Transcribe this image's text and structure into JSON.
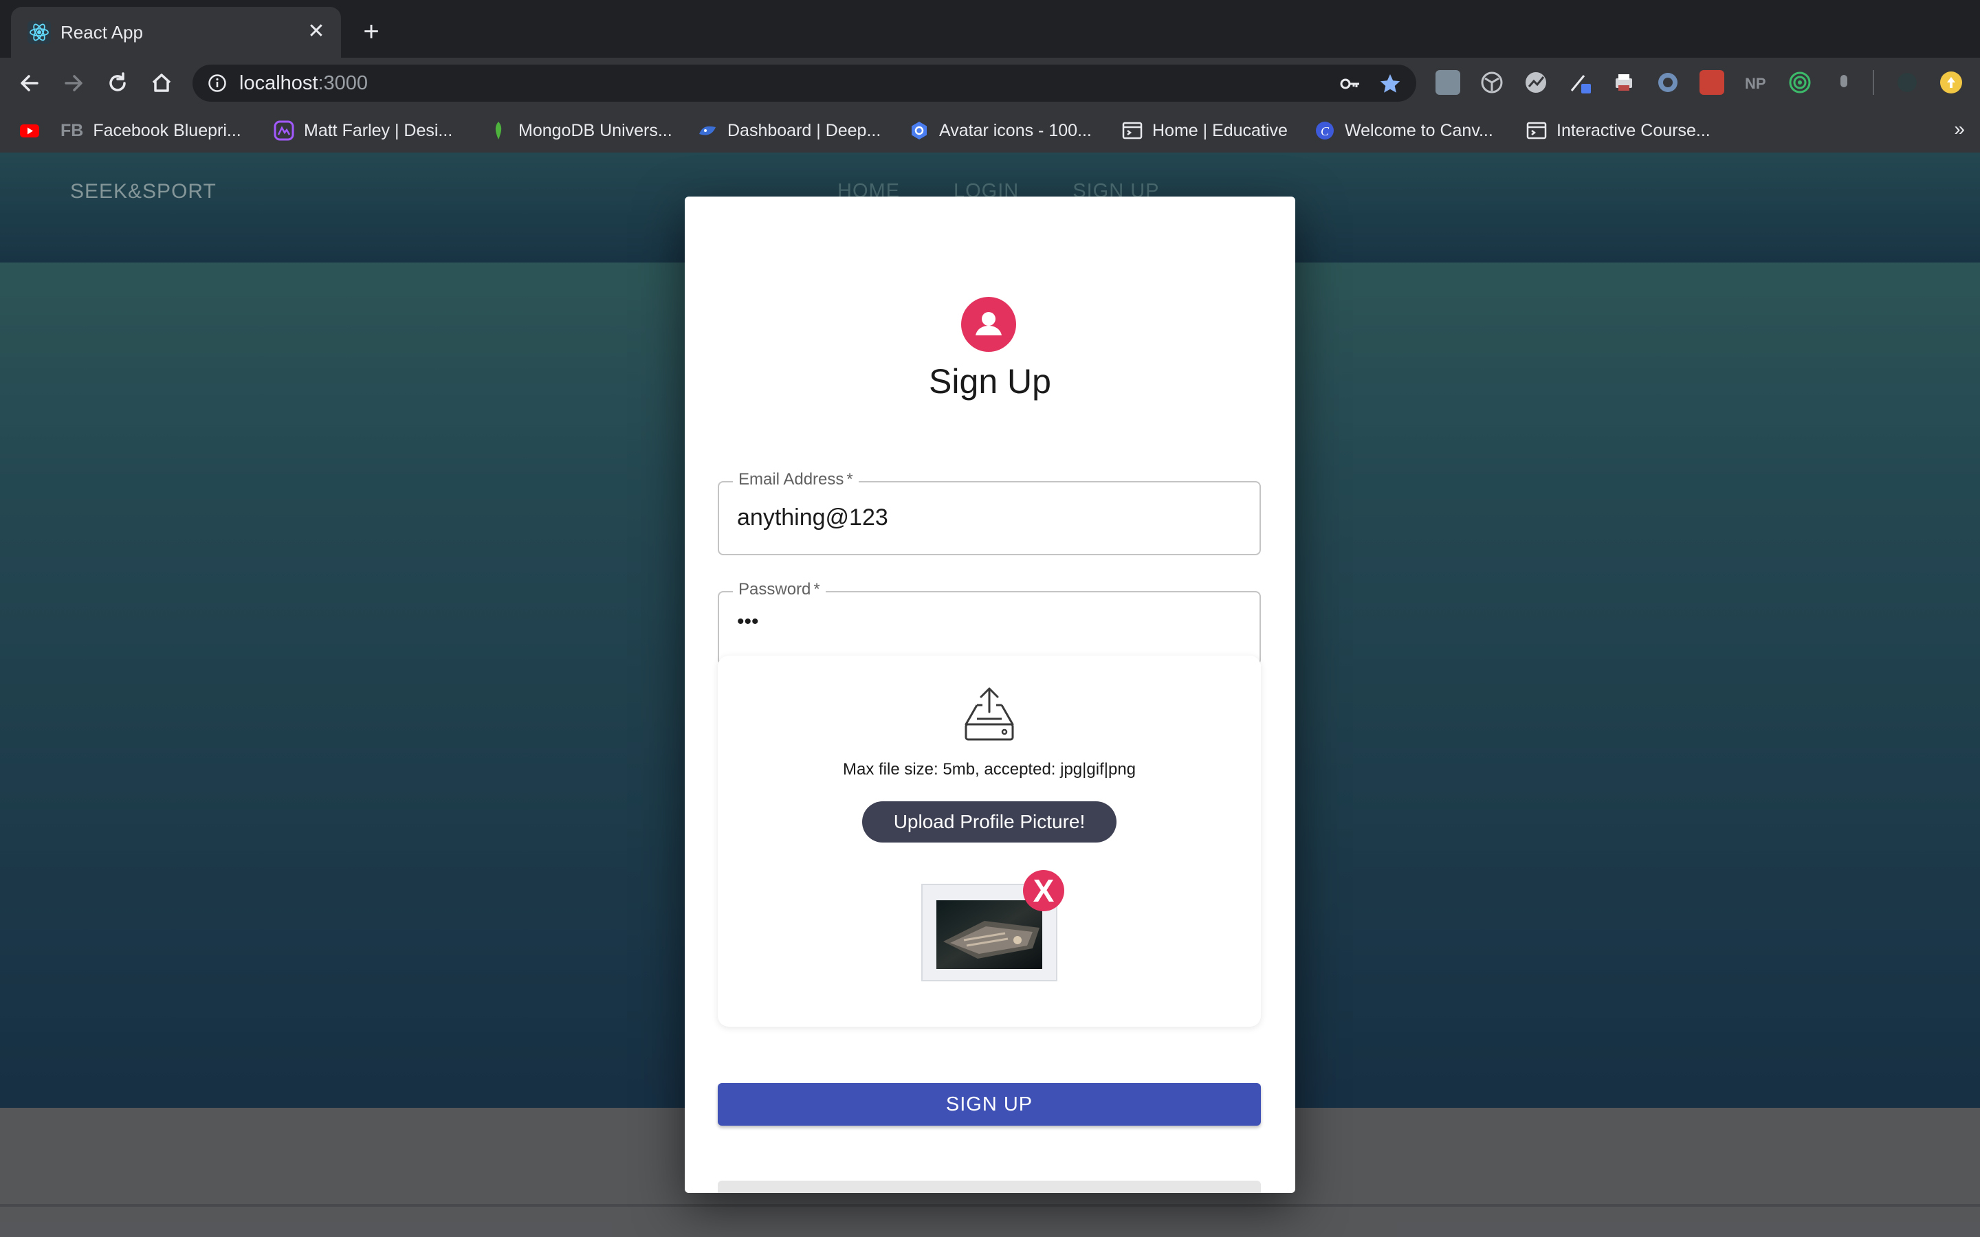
{
  "browser": {
    "tab_title": "React App",
    "tab_close": "✕",
    "new_tab": "+",
    "url_host": "localhost",
    "url_port": ":3000",
    "more_bookmarks": "»",
    "bookmarks": [
      {
        "label": "",
        "icon": "youtube-icon"
      },
      {
        "label": "Facebook Bluepri...",
        "prefix": "FB",
        "icon": "fb-text-icon"
      },
      {
        "label": "Matt Farley | Desi...",
        "icon": "portfolio-icon"
      },
      {
        "label": "MongoDB Univers...",
        "icon": "mongodb-leaf-icon"
      },
      {
        "label": "Dashboard | Deep...",
        "icon": "deepnote-icon"
      },
      {
        "label": "Avatar icons - 100...",
        "icon": "google-icon"
      },
      {
        "label": "Home | Educative",
        "icon": "educative-icon"
      },
      {
        "label": "Welcome to Canv...",
        "icon": "canva-icon"
      },
      {
        "label": "Interactive Course...",
        "icon": "course-icon"
      }
    ]
  },
  "site": {
    "brand": "SEEK&SPORT",
    "nav": [
      "HOME",
      "LOGIN",
      "SIGN UP"
    ]
  },
  "form": {
    "title": "Sign Up",
    "email_label": "Email Address",
    "email_value": "anything@123",
    "password_label": "Password",
    "password_value": "•••",
    "required_mark": "*",
    "dropzone_text": "Max file size: 5mb, accepted: jpg|gif|png",
    "upload_button": "Upload Profile Picture!",
    "remove_label": "X",
    "submit_button": "SIGN UP"
  },
  "colors": {
    "accent_pink": "#e3325d",
    "primary_blue": "#3f51b5",
    "upload_button_bg": "#3e4053"
  }
}
